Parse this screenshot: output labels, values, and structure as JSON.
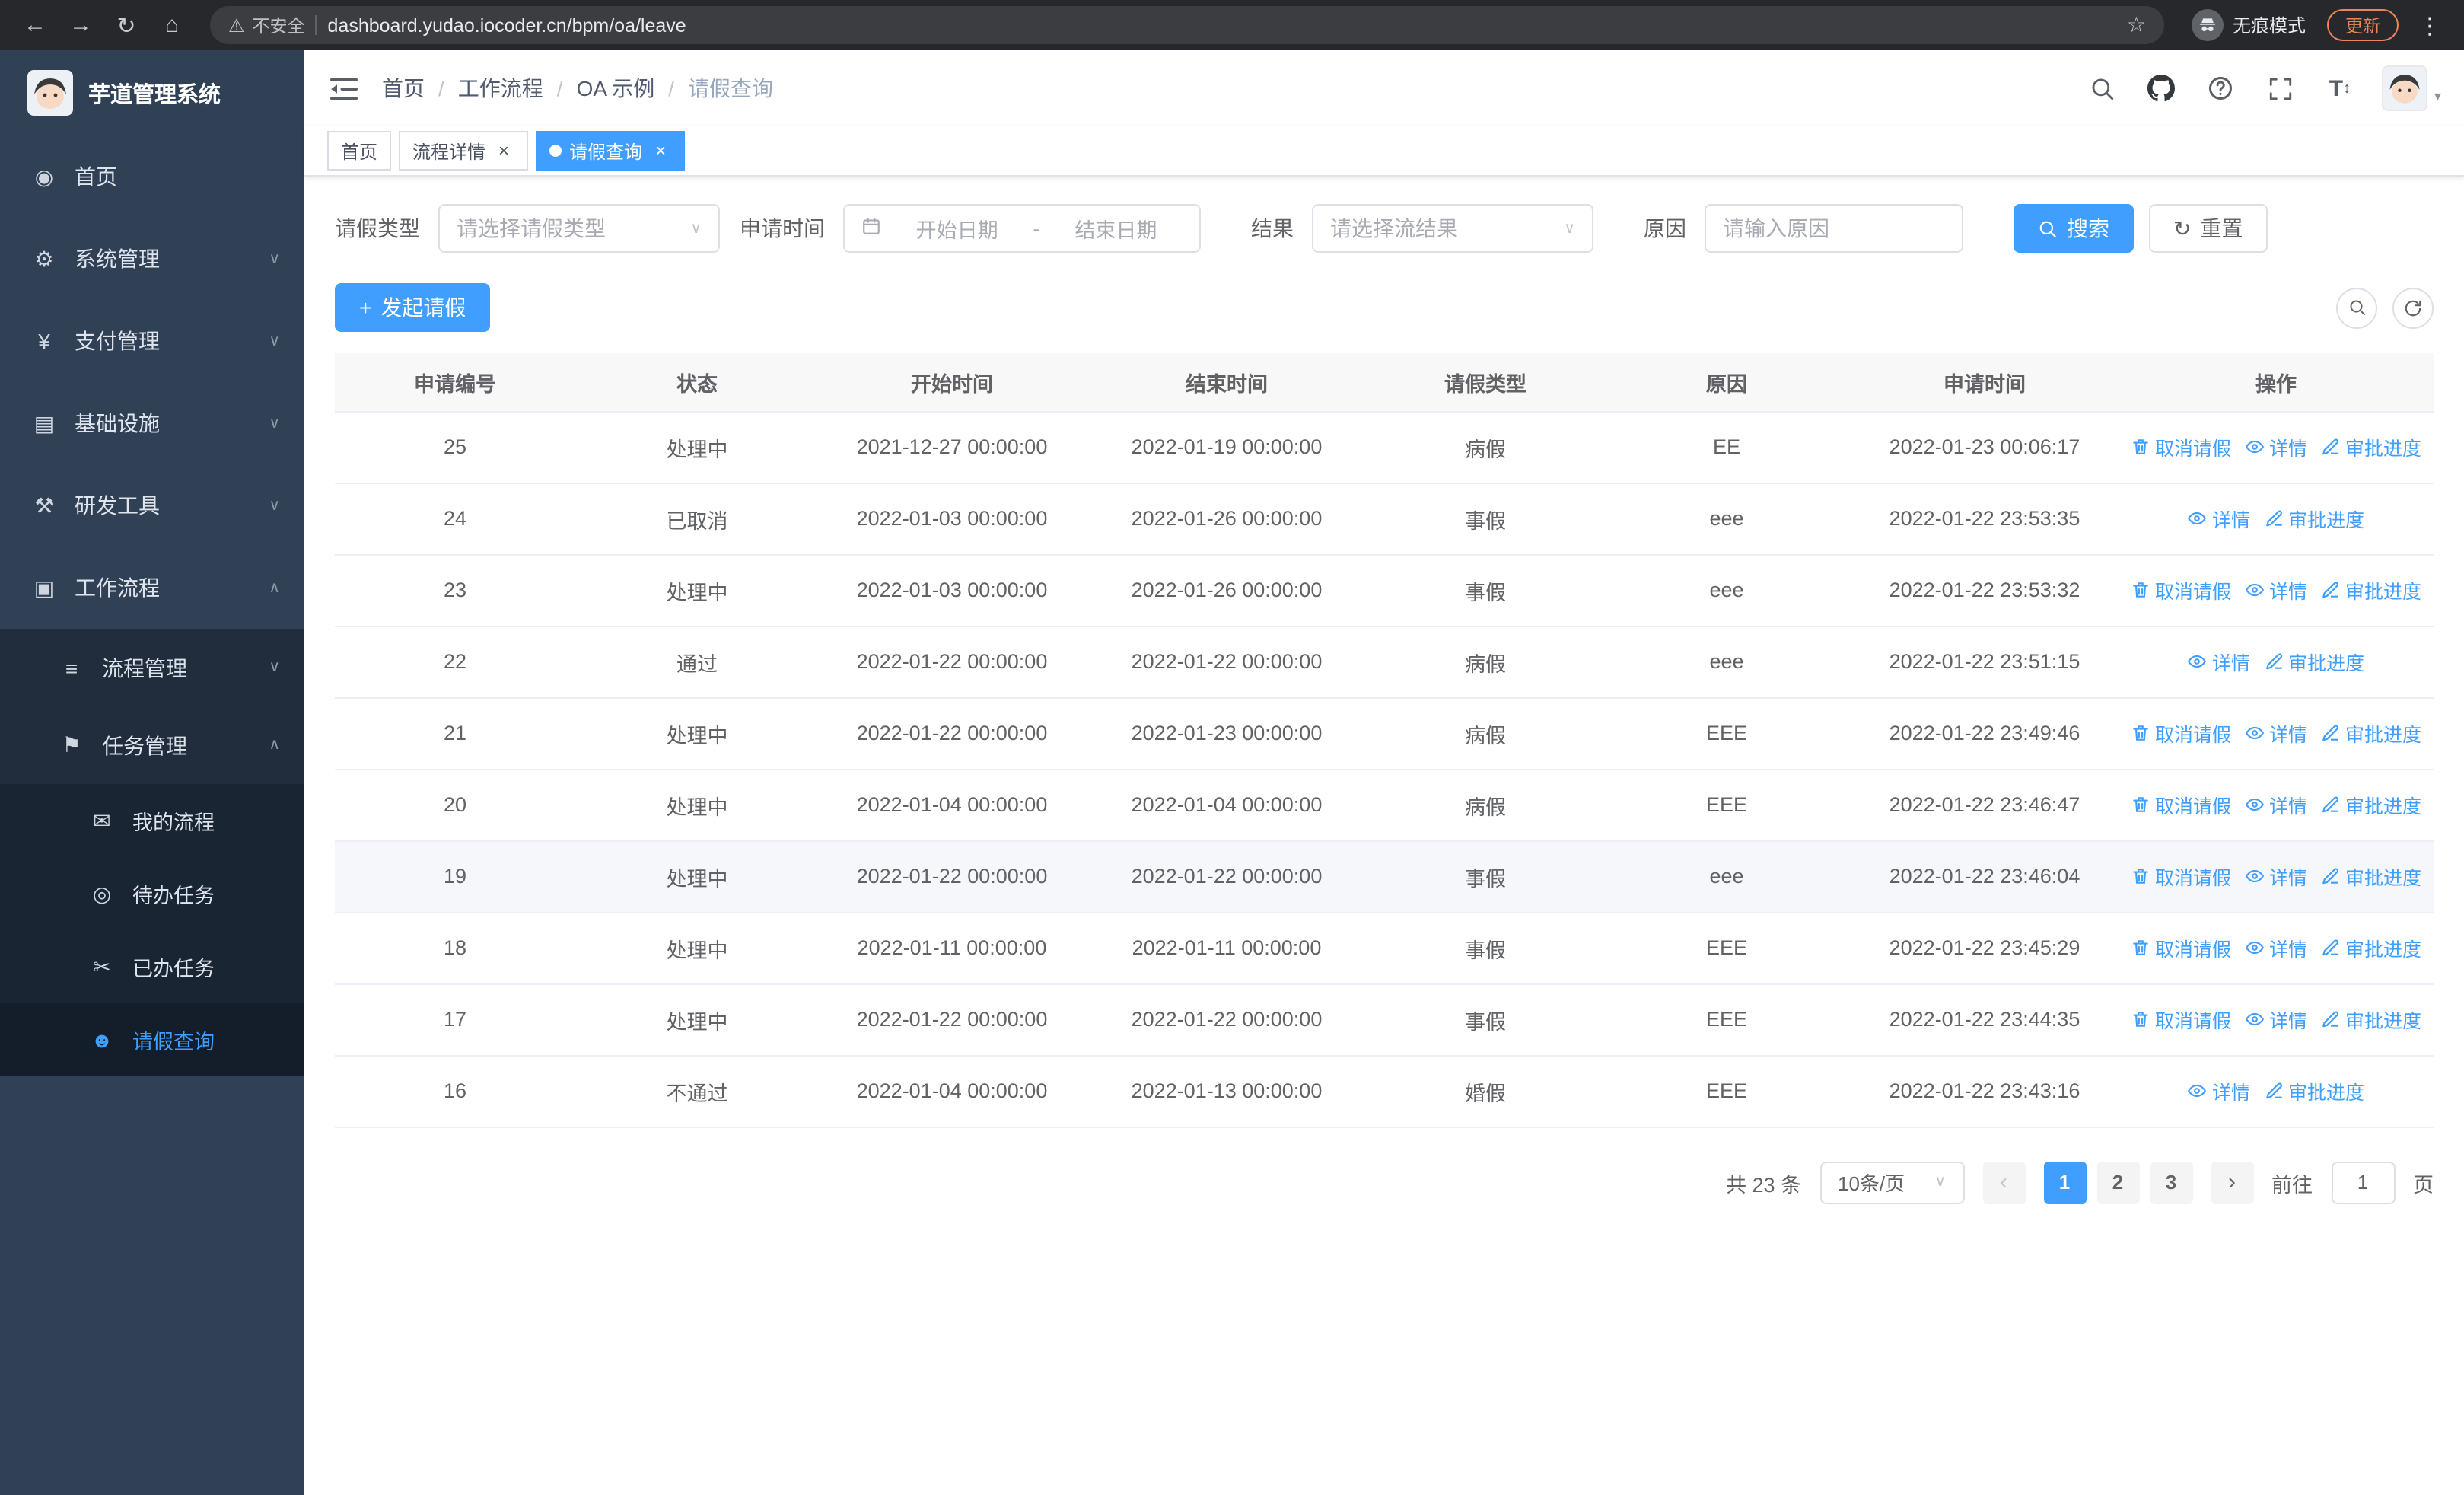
{
  "browser": {
    "security_warning": "不安全",
    "url": "dashboard.yudao.iocoder.cn/bpm/oa/leave",
    "incognito_label": "无痕模式",
    "update_button": "更新"
  },
  "sidebar": {
    "app_title": "芋道管理系统",
    "items": [
      {
        "label": "首页",
        "icon": "dashboard-icon"
      },
      {
        "label": "系统管理",
        "icon": "gear-icon",
        "expandable": true
      },
      {
        "label": "支付管理",
        "icon": "yen-icon",
        "expandable": true
      },
      {
        "label": "基础设施",
        "icon": "infrastructure-icon",
        "expandable": true
      },
      {
        "label": "研发工具",
        "icon": "tools-icon",
        "expandable": true
      },
      {
        "label": "工作流程",
        "icon": "workflow-icon",
        "expanded": true
      }
    ],
    "workflow_children": [
      {
        "label": "流程管理",
        "icon": "list-icon",
        "expandable": true
      },
      {
        "label": "任务管理",
        "icon": "flag-icon",
        "expanded": true
      }
    ],
    "task_children": [
      {
        "label": "我的流程",
        "icon": "chat-icon"
      },
      {
        "label": "待办任务",
        "icon": "eye-icon"
      },
      {
        "label": "已办任务",
        "icon": "done-icon"
      },
      {
        "label": "请假查询",
        "icon": "user-icon",
        "active": true
      }
    ]
  },
  "header": {
    "breadcrumb": [
      "首页",
      "工作流程",
      "OA 示例",
      "请假查询"
    ]
  },
  "tabs": [
    {
      "label": "首页"
    },
    {
      "label": "流程详情",
      "closable": true
    },
    {
      "label": "请假查询",
      "closable": true,
      "active": true
    }
  ],
  "filters": {
    "leave_type_label": "请假类型",
    "leave_type_placeholder": "请选择请假类型",
    "apply_time_label": "申请时间",
    "start_date_placeholder": "开始日期",
    "range_separator": "-",
    "end_date_placeholder": "结束日期",
    "result_label": "结果",
    "result_placeholder": "请选择流结果",
    "reason_label": "原因",
    "reason_placeholder": "请输入原因",
    "search_button": "搜索",
    "reset_button": "重置"
  },
  "toolbar": {
    "create_button": "发起请假"
  },
  "table": {
    "columns": [
      "申请编号",
      "状态",
      "开始时间",
      "结束时间",
      "请假类型",
      "原因",
      "申请时间",
      "操作"
    ],
    "action_labels": {
      "cancel": "取消请假",
      "detail": "详情",
      "progress": "审批进度"
    },
    "rows": [
      {
        "id": "25",
        "status": "处理中",
        "start": "2021-12-27 00:00:00",
        "end": "2022-01-19 00:00:00",
        "type": "病假",
        "reason": "EE",
        "applied": "2022-01-23 00:06:17",
        "actions": [
          "cancel",
          "detail",
          "progress"
        ]
      },
      {
        "id": "24",
        "status": "已取消",
        "start": "2022-01-03 00:00:00",
        "end": "2022-01-26 00:00:00",
        "type": "事假",
        "reason": "eee",
        "applied": "2022-01-22 23:53:35",
        "actions": [
          "detail",
          "progress"
        ]
      },
      {
        "id": "23",
        "status": "处理中",
        "start": "2022-01-03 00:00:00",
        "end": "2022-01-26 00:00:00",
        "type": "事假",
        "reason": "eee",
        "applied": "2022-01-22 23:53:32",
        "actions": [
          "cancel",
          "detail",
          "progress"
        ]
      },
      {
        "id": "22",
        "status": "通过",
        "start": "2022-01-22 00:00:00",
        "end": "2022-01-22 00:00:00",
        "type": "病假",
        "reason": "eee",
        "applied": "2022-01-22 23:51:15",
        "actions": [
          "detail",
          "progress"
        ]
      },
      {
        "id": "21",
        "status": "处理中",
        "start": "2022-01-22 00:00:00",
        "end": "2022-01-23 00:00:00",
        "type": "病假",
        "reason": "EEE",
        "applied": "2022-01-22 23:49:46",
        "actions": [
          "cancel",
          "detail",
          "progress"
        ]
      },
      {
        "id": "20",
        "status": "处理中",
        "start": "2022-01-04 00:00:00",
        "end": "2022-01-04 00:00:00",
        "type": "病假",
        "reason": "EEE",
        "applied": "2022-01-22 23:46:47",
        "actions": [
          "cancel",
          "detail",
          "progress"
        ]
      },
      {
        "id": "19",
        "status": "处理中",
        "start": "2022-01-22 00:00:00",
        "end": "2022-01-22 00:00:00",
        "type": "事假",
        "reason": "eee",
        "applied": "2022-01-22 23:46:04",
        "actions": [
          "cancel",
          "detail",
          "progress"
        ],
        "hover": true
      },
      {
        "id": "18",
        "status": "处理中",
        "start": "2022-01-11 00:00:00",
        "end": "2022-01-11 00:00:00",
        "type": "事假",
        "reason": "EEE",
        "applied": "2022-01-22 23:45:29",
        "actions": [
          "cancel",
          "detail",
          "progress"
        ]
      },
      {
        "id": "17",
        "status": "处理中",
        "start": "2022-01-22 00:00:00",
        "end": "2022-01-22 00:00:00",
        "type": "事假",
        "reason": "EEE",
        "applied": "2022-01-22 23:44:35",
        "actions": [
          "cancel",
          "detail",
          "progress"
        ]
      },
      {
        "id": "16",
        "status": "不通过",
        "start": "2022-01-04 00:00:00",
        "end": "2022-01-13 00:00:00",
        "type": "婚假",
        "reason": "EEE",
        "applied": "2022-01-22 23:43:16",
        "actions": [
          "detail",
          "progress"
        ]
      }
    ]
  },
  "pagination": {
    "total_text": "共 23 条",
    "page_size": "10条/页",
    "pages": [
      "1",
      "2",
      "3"
    ],
    "active_page": "1",
    "goto_label": "前往",
    "goto_value": "1",
    "goto_suffix": "页"
  },
  "colors": {
    "primary": "#409eff",
    "sidebar_bg": "#304156",
    "active_tab_bg": "#409eff"
  }
}
